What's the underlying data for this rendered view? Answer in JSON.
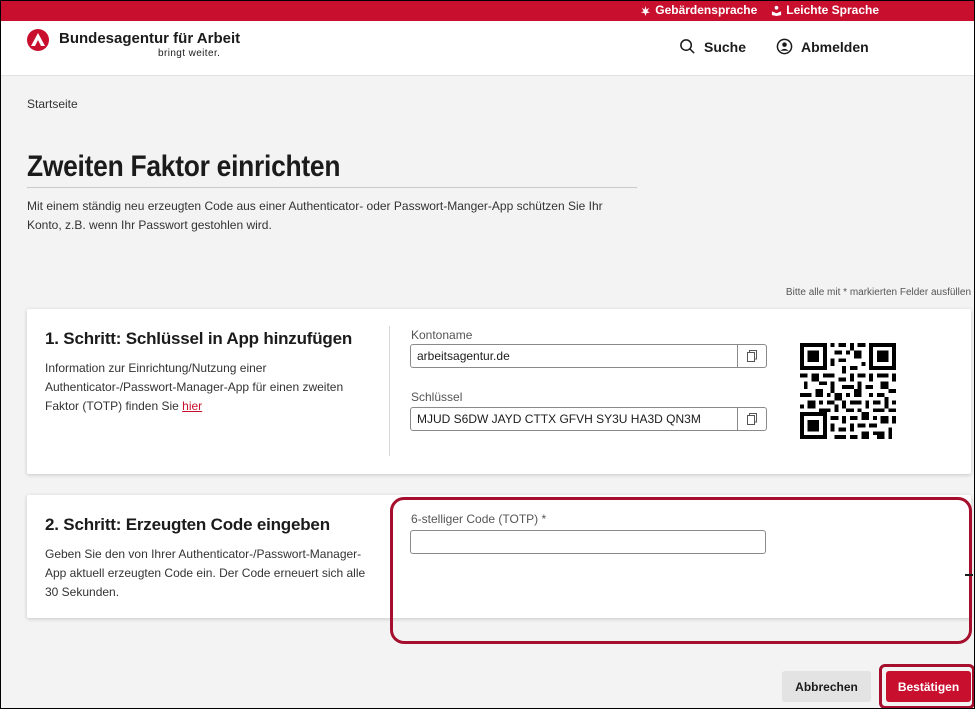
{
  "topbar": {
    "sign_language": "Gebärdensprache",
    "easy_language": "Leichte Sprache"
  },
  "header": {
    "brand": "Bundesagentur für Arbeit",
    "tagline": "bringt weiter.",
    "search": "Suche",
    "logout": "Abmelden"
  },
  "breadcrumb": "Startseite",
  "page": {
    "title": "Zweiten Faktor einrichten",
    "intro": "Mit einem ständig neu erzeugten Code aus einer Authenticator- oder Passwort-Manger-App schützen Sie Ihr Konto, z.B. wenn Ihr Passwort gestohlen wird.",
    "required_note": "Bitte alle mit * markierten Felder ausfüllen"
  },
  "step1": {
    "heading": "1. Schritt: Schlüssel in App hinzufügen",
    "text": "Information zur Einrichtung/Nutzung einer Authenticator-/Passwort-Manager-App für einen zweiten Faktor (TOTP) finden Sie",
    "link": "hier",
    "account_label": "Kontoname",
    "account_value": "arbeitsagentur.de",
    "key_label": "Schlüssel",
    "key_value": "MJUD S6DW JAYD CTTX GFVH SY3U HA3D QN3M"
  },
  "step2": {
    "heading": "2. Schritt: Erzeugten Code eingeben",
    "text": "Geben Sie den von Ihrer Authenticator-/Passwort-Manager-App aktuell erzeugten Code ein. Der Code erneuert sich alle 30 Sekunden.",
    "code_label": "6-stelliger Code (TOTP) *",
    "code_value": ""
  },
  "actions": {
    "cancel": "Abbrechen",
    "confirm": "Bestätigen"
  },
  "colors": {
    "brand_red": "#c8102e",
    "highlight": "#a50f2d"
  }
}
